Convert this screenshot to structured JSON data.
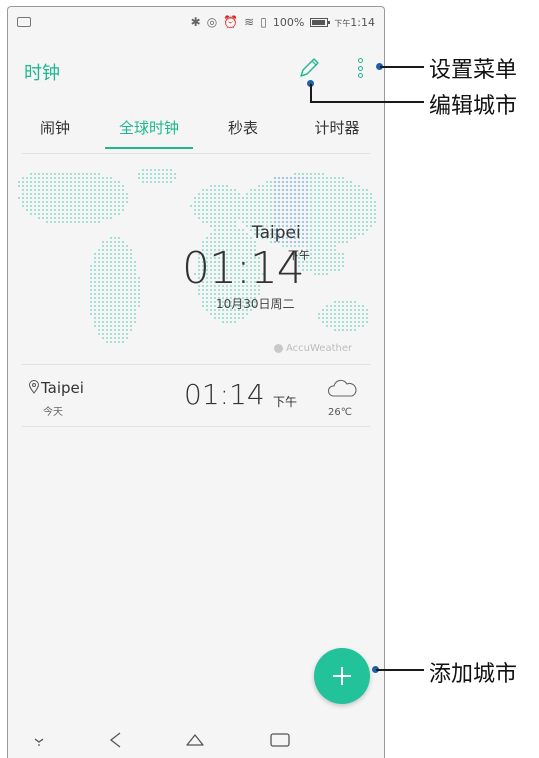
{
  "status_bar": {
    "battery_percent": "100%",
    "time_prefix": "下午",
    "time": "1:14"
  },
  "app_bar": {
    "title": "时钟",
    "icons": [
      "pencil-edit-icon",
      "more-vert-icon"
    ]
  },
  "tabs": [
    {
      "label": "闹钟",
      "active": false
    },
    {
      "label": "全球时钟",
      "active": true
    },
    {
      "label": "秒表",
      "active": false
    },
    {
      "label": "计时器",
      "active": false
    }
  ],
  "map_card": {
    "city": "Taipei",
    "time": "01:14",
    "ampm": "下午",
    "date": "10月30日周二",
    "provider": "AccuWeather"
  },
  "city_list": [
    {
      "city": "Taipei",
      "day": "今天",
      "time": "01:14",
      "ampm": "下午",
      "weather_icon": "cloud-icon",
      "temperature": "26℃"
    }
  ],
  "callouts": {
    "settings_menu": "设置菜单",
    "edit_cities": "编辑城市",
    "add_city": "添加城市"
  },
  "colors": {
    "accent": "#1fb890",
    "fab": "#22c39a",
    "callout_dot": "#1f5fa8",
    "map_dots": "#a6e0d2",
    "map_highlight": "#9ec7e6"
  }
}
